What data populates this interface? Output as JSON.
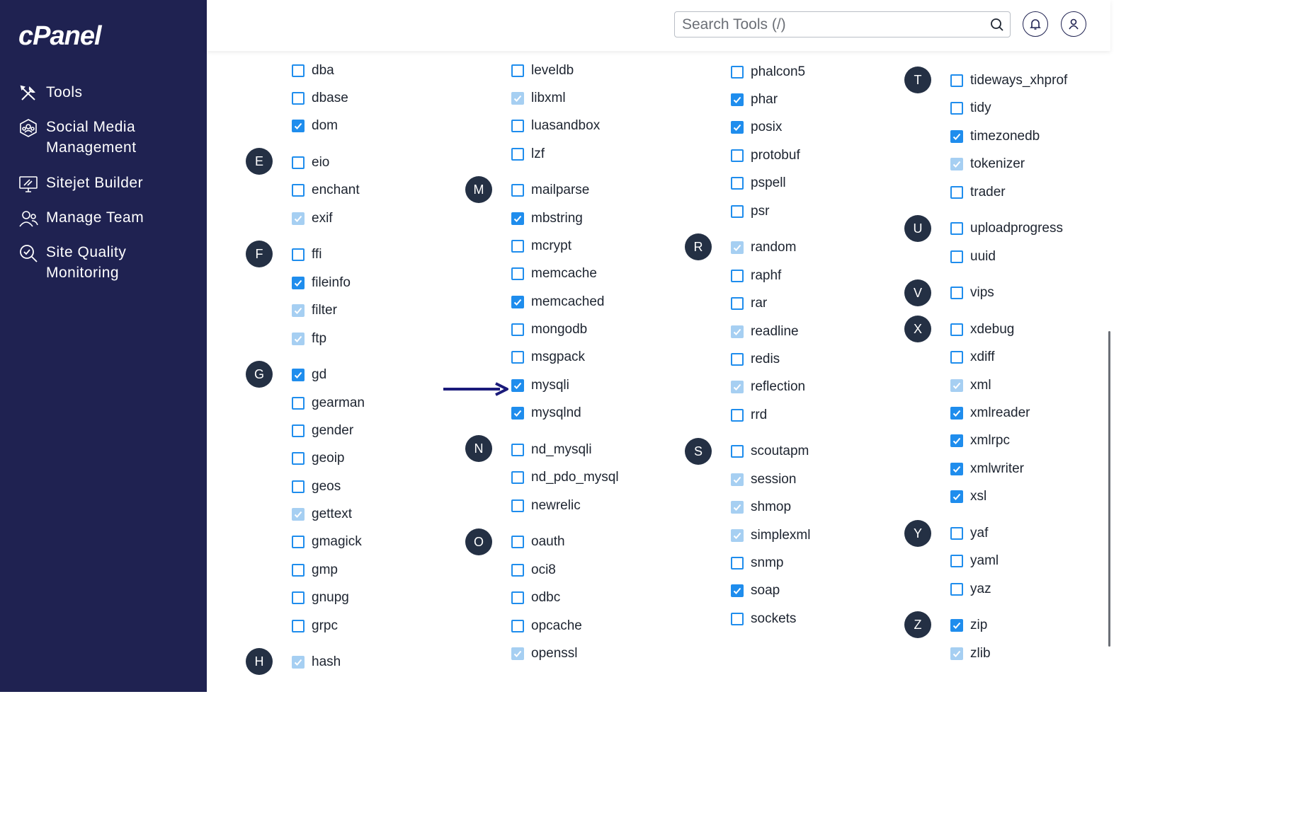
{
  "app": {
    "logo": "cPanel"
  },
  "sidebar": {
    "items": [
      {
        "label": "Tools",
        "icon": "tools-icon"
      },
      {
        "label": "Social Media Management",
        "icon": "social-media-icon"
      },
      {
        "label": "Sitejet Builder",
        "icon": "sitejet-icon"
      },
      {
        "label": "Manage Team",
        "icon": "team-icon"
      },
      {
        "label": "Site Quality Monitoring",
        "icon": "site-quality-icon"
      }
    ]
  },
  "header": {
    "search_placeholder": "Search Tools (/)",
    "icons": [
      "search-icon",
      "bell-icon",
      "user-icon"
    ]
  },
  "colors": {
    "sidebar_bg": "#1f2251",
    "checkbox": "#1f8ded",
    "checkbox_disabled": "#a6cff2",
    "badge": "#243044"
  },
  "badges": [
    "E",
    "F",
    "G",
    "H",
    "M",
    "N",
    "O",
    "R",
    "S",
    "T",
    "U",
    "V",
    "X",
    "Y",
    "Z"
  ],
  "extensions": {
    "col1": [
      {
        "name": "dba",
        "state": "unchecked"
      },
      {
        "name": "dbase",
        "state": "unchecked"
      },
      {
        "name": "dom",
        "state": "checked"
      },
      {
        "name": "eio",
        "state": "unchecked"
      },
      {
        "name": "enchant",
        "state": "unchecked"
      },
      {
        "name": "exif",
        "state": "checked-disabled"
      },
      {
        "name": "ffi",
        "state": "unchecked"
      },
      {
        "name": "fileinfo",
        "state": "checked"
      },
      {
        "name": "filter",
        "state": "checked-disabled"
      },
      {
        "name": "ftp",
        "state": "checked-disabled"
      },
      {
        "name": "gd",
        "state": "checked"
      },
      {
        "name": "gearman",
        "state": "unchecked"
      },
      {
        "name": "gender",
        "state": "unchecked"
      },
      {
        "name": "geoip",
        "state": "unchecked"
      },
      {
        "name": "geos",
        "state": "unchecked"
      },
      {
        "name": "gettext",
        "state": "checked-disabled"
      },
      {
        "name": "gmagick",
        "state": "unchecked"
      },
      {
        "name": "gmp",
        "state": "unchecked"
      },
      {
        "name": "gnupg",
        "state": "unchecked"
      },
      {
        "name": "grpc",
        "state": "unchecked"
      },
      {
        "name": "hash",
        "state": "checked-disabled"
      }
    ],
    "col2": [
      {
        "name": "leveldb",
        "state": "unchecked"
      },
      {
        "name": "libxml",
        "state": "checked-disabled"
      },
      {
        "name": "luasandbox",
        "state": "unchecked"
      },
      {
        "name": "lzf",
        "state": "unchecked"
      },
      {
        "name": "mailparse",
        "state": "unchecked"
      },
      {
        "name": "mbstring",
        "state": "checked"
      },
      {
        "name": "mcrypt",
        "state": "unchecked"
      },
      {
        "name": "memcache",
        "state": "unchecked"
      },
      {
        "name": "memcached",
        "state": "checked"
      },
      {
        "name": "mongodb",
        "state": "unchecked"
      },
      {
        "name": "msgpack",
        "state": "unchecked"
      },
      {
        "name": "mysqli",
        "state": "checked"
      },
      {
        "name": "mysqlnd",
        "state": "checked"
      },
      {
        "name": "nd_mysqli",
        "state": "unchecked"
      },
      {
        "name": "nd_pdo_mysql",
        "state": "unchecked"
      },
      {
        "name": "newrelic",
        "state": "unchecked"
      },
      {
        "name": "oauth",
        "state": "unchecked"
      },
      {
        "name": "oci8",
        "state": "unchecked"
      },
      {
        "name": "odbc",
        "state": "unchecked"
      },
      {
        "name": "opcache",
        "state": "unchecked"
      },
      {
        "name": "openssl",
        "state": "checked-disabled"
      }
    ],
    "col3": [
      {
        "name": "phalcon5",
        "state": "unchecked"
      },
      {
        "name": "phar",
        "state": "checked"
      },
      {
        "name": "posix",
        "state": "checked"
      },
      {
        "name": "protobuf",
        "state": "unchecked"
      },
      {
        "name": "pspell",
        "state": "unchecked"
      },
      {
        "name": "psr",
        "state": "unchecked"
      },
      {
        "name": "random",
        "state": "checked-disabled"
      },
      {
        "name": "raphf",
        "state": "unchecked"
      },
      {
        "name": "rar",
        "state": "unchecked"
      },
      {
        "name": "readline",
        "state": "checked-disabled"
      },
      {
        "name": "redis",
        "state": "unchecked"
      },
      {
        "name": "reflection",
        "state": "checked-disabled"
      },
      {
        "name": "rrd",
        "state": "unchecked"
      },
      {
        "name": "scoutapm",
        "state": "unchecked"
      },
      {
        "name": "session",
        "state": "checked-disabled"
      },
      {
        "name": "shmop",
        "state": "checked-disabled"
      },
      {
        "name": "simplexml",
        "state": "checked-disabled"
      },
      {
        "name": "snmp",
        "state": "unchecked"
      },
      {
        "name": "soap",
        "state": "checked"
      },
      {
        "name": "sockets",
        "state": "unchecked"
      }
    ],
    "col4": [
      {
        "name": "tideways_xhprof",
        "state": "unchecked"
      },
      {
        "name": "tidy",
        "state": "unchecked"
      },
      {
        "name": "timezonedb",
        "state": "checked"
      },
      {
        "name": "tokenizer",
        "state": "checked-disabled"
      },
      {
        "name": "trader",
        "state": "unchecked"
      },
      {
        "name": "uploadprogress",
        "state": "unchecked"
      },
      {
        "name": "uuid",
        "state": "unchecked"
      },
      {
        "name": "vips",
        "state": "unchecked"
      },
      {
        "name": "xdebug",
        "state": "unchecked"
      },
      {
        "name": "xdiff",
        "state": "unchecked"
      },
      {
        "name": "xml",
        "state": "checked-disabled"
      },
      {
        "name": "xmlreader",
        "state": "checked"
      },
      {
        "name": "xmlrpc",
        "state": "checked"
      },
      {
        "name": "xmlwriter",
        "state": "checked"
      },
      {
        "name": "xsl",
        "state": "checked"
      },
      {
        "name": "yaf",
        "state": "unchecked"
      },
      {
        "name": "yaml",
        "state": "unchecked"
      },
      {
        "name": "yaz",
        "state": "unchecked"
      },
      {
        "name": "zip",
        "state": "checked"
      },
      {
        "name": "zlib",
        "state": "checked-disabled"
      }
    ]
  }
}
